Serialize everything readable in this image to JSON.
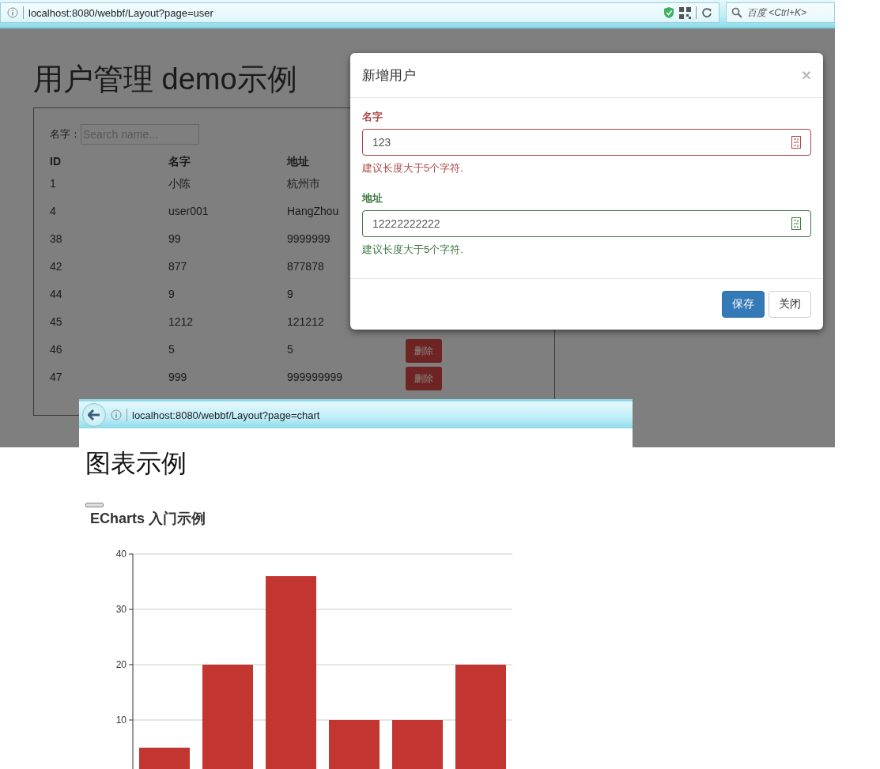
{
  "browser_top": {
    "url": "localhost:8080/webbf/Layout?page=user",
    "search": {
      "placeholder": "百度 <Ctrl+K>"
    }
  },
  "user_page": {
    "title": "用户管理 demo示例",
    "filter": {
      "label": "名字：",
      "placeholder": "Search name..."
    },
    "table": {
      "columns": [
        "ID",
        "名字",
        "地址"
      ],
      "rows": [
        {
          "cells": [
            "1",
            "小陈",
            "杭州市"
          ]
        },
        {
          "cells": [
            "4",
            "user001",
            "HangZhou"
          ]
        },
        {
          "cells": [
            "38",
            "99",
            "9999999"
          ]
        },
        {
          "cells": [
            "42",
            "877",
            "877878"
          ]
        },
        {
          "cells": [
            "44",
            "9",
            "9"
          ]
        },
        {
          "cells": [
            "45",
            "1212",
            "121212"
          ]
        },
        {
          "cells": [
            "46",
            "5",
            "5"
          ],
          "action": "删除"
        },
        {
          "cells": [
            "47",
            "999",
            "999999999"
          ],
          "action": "删除"
        }
      ]
    }
  },
  "modal": {
    "title": "新增用户",
    "close": "×",
    "fields": [
      {
        "label": "名字",
        "value": "123",
        "help": "建议长度大于5个字符.",
        "kind": "error"
      },
      {
        "label": "地址",
        "value": "12222222222",
        "help": "建议长度大于5个字符.",
        "kind": "success"
      }
    ],
    "buttons": [
      {
        "label": "保存",
        "kind": "primary"
      },
      {
        "label": "关闭",
        "kind": "default"
      }
    ]
  },
  "browser_bottom": {
    "url": "localhost:8080/webbf/Layout?page=chart"
  },
  "chart_page": {
    "title": "图表示例",
    "chart_title": "ECharts 入门示例",
    "chart_data": {
      "type": "bar",
      "values": [
        5,
        20,
        36,
        10,
        10,
        20
      ],
      "color": "#c23531",
      "grid": true,
      "ylim": [
        0,
        40
      ],
      "yticks": [
        10,
        20,
        30,
        40
      ]
    }
  }
}
